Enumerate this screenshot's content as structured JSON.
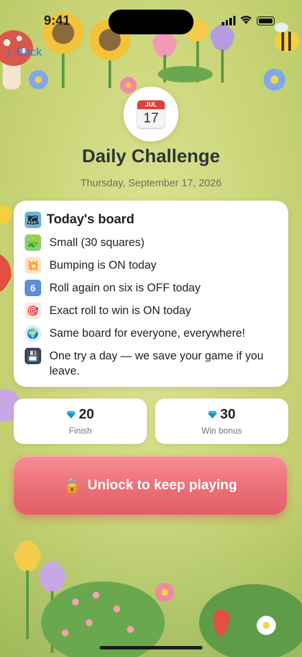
{
  "status_bar": {
    "time": "9:41"
  },
  "nav": {
    "back_label": "Back"
  },
  "header": {
    "calendar_month": "JUL",
    "calendar_day": "17",
    "title": "Daily Challenge",
    "date": "Thursday, September 17, 2026"
  },
  "board": {
    "title": "Today's board",
    "title_icon": "map-icon",
    "rules": [
      {
        "icon": "puzzle-piece-icon",
        "text": "Small (30 squares)"
      },
      {
        "icon": "collision-icon",
        "text": "Bumping is ON today"
      },
      {
        "icon": "keycap-six-icon",
        "text": "Roll again on six is OFF today"
      },
      {
        "icon": "target-dart-icon",
        "text": "Exact roll to win is ON today"
      },
      {
        "icon": "globe-icon",
        "text": "Same board for everyone, everywhere!"
      },
      {
        "icon": "floppy-disk-icon",
        "text": "One try a day — we save your game if you leave."
      }
    ]
  },
  "rewards": {
    "finish": {
      "value": "20",
      "label": "Finish",
      "icon": "gem-icon"
    },
    "win_bonus": {
      "value": "30",
      "label": "Win bonus",
      "icon": "gem-icon"
    }
  },
  "cta": {
    "label": "Unlock to keep playing",
    "icon": "lock-icon"
  },
  "colors": {
    "accent_blue": "#2b7be0",
    "cta_pink": "#ec6e76",
    "background_green": "#cfd97f"
  }
}
